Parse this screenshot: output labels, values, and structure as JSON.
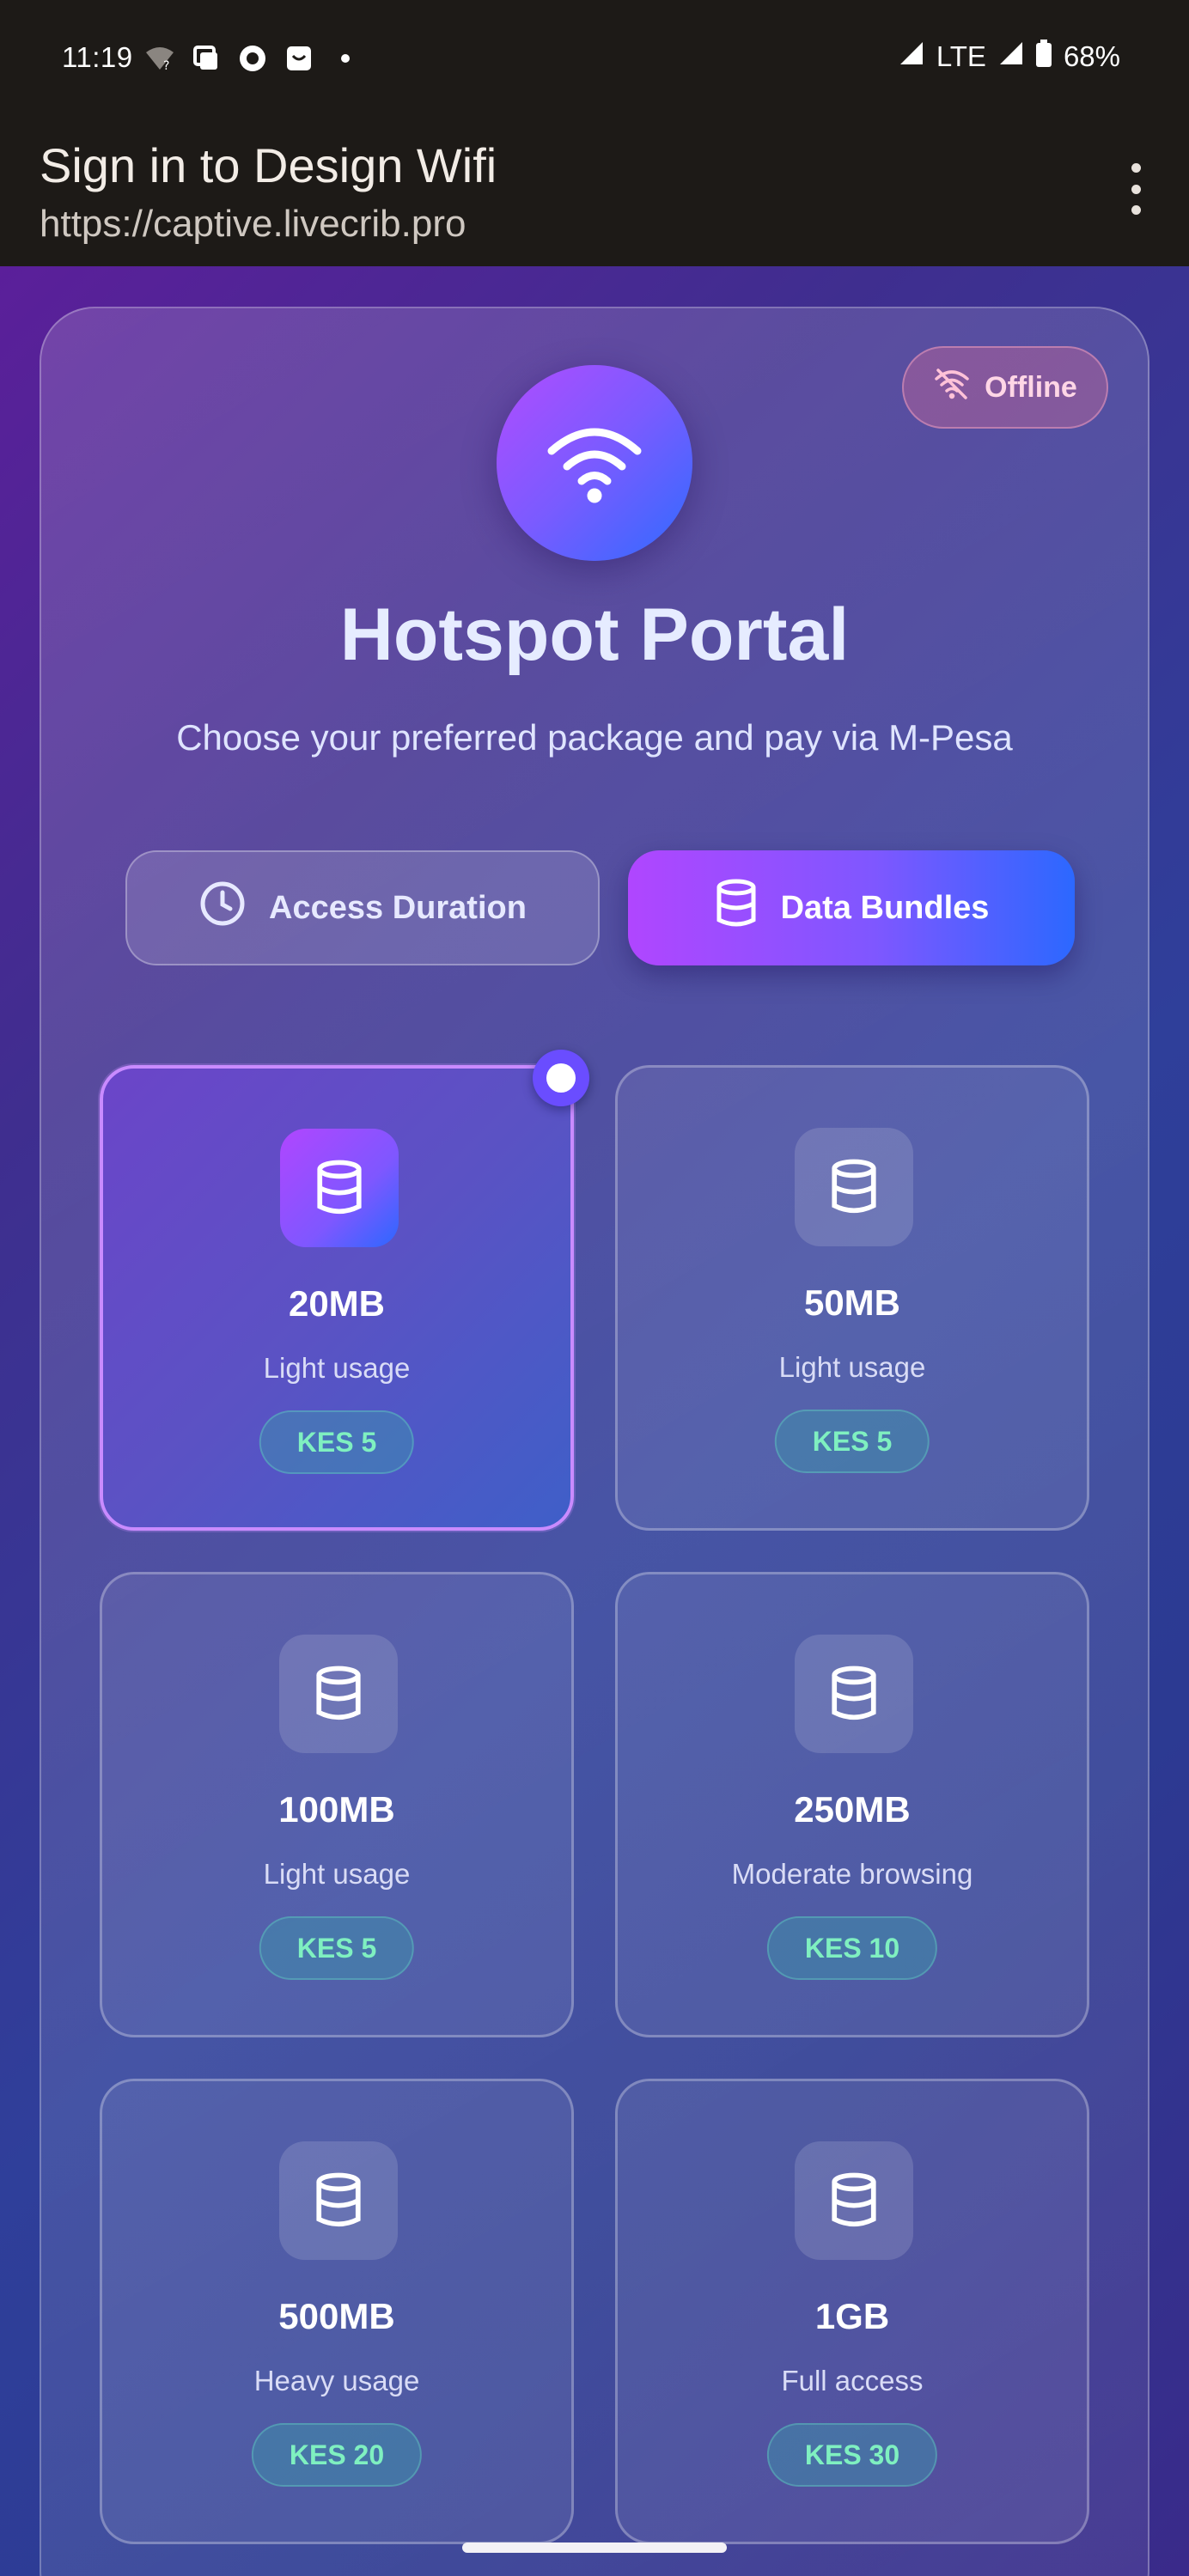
{
  "status_bar": {
    "time": "11:19",
    "network": "LTE",
    "battery": "68%"
  },
  "app_bar": {
    "title": "Sign in to Design Wifi",
    "url": "https://captive.livecrib.pro"
  },
  "portal": {
    "offline_label": "Offline",
    "title": "Hotspot Portal",
    "subtitle": "Choose your preferred package and pay via M-Pesa",
    "tabs": [
      {
        "label": "Access Duration",
        "active": false
      },
      {
        "label": "Data Bundles",
        "active": true
      }
    ],
    "packages": [
      {
        "size": "20MB",
        "desc": "Light usage",
        "price": "KES 5",
        "selected": true
      },
      {
        "size": "50MB",
        "desc": "Light usage",
        "price": "KES 5",
        "selected": false
      },
      {
        "size": "100MB",
        "desc": "Light usage",
        "price": "KES 5",
        "selected": false
      },
      {
        "size": "250MB",
        "desc": "Moderate browsing",
        "price": "KES 10",
        "selected": false
      },
      {
        "size": "500MB",
        "desc": "Heavy usage",
        "price": "KES 20",
        "selected": false
      },
      {
        "size": "1GB",
        "desc": "Full access",
        "price": "KES 30",
        "selected": false
      }
    ]
  },
  "colors": {
    "accent_purple": "#b046ff",
    "accent_blue": "#2c68ff",
    "price_green": "#7ff0c0",
    "offline_pink": "#ffd6e6"
  }
}
